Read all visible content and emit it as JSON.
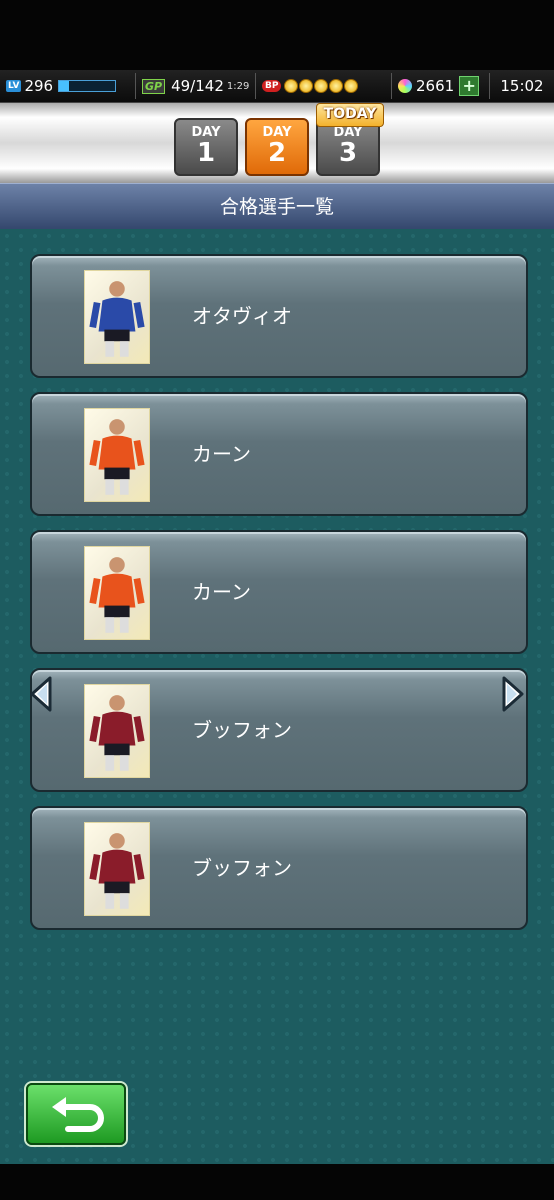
{
  "status": {
    "lv_label": "LV",
    "level": "296",
    "level_progress": 0.18,
    "gp_label": "GP",
    "gp_value": "49/142",
    "gp_timer": "1:29",
    "bp_label": "BP",
    "bp_count": 5,
    "gems": "2661",
    "clock": "15:02",
    "icons": [
      "lv-badge",
      "gp-badge",
      "bp-coin-icon",
      "gem-icon",
      "plus-icon"
    ]
  },
  "days": {
    "today_label": "TODAY",
    "items": [
      {
        "label": "DAY",
        "number": "1",
        "selected": false
      },
      {
        "label": "DAY",
        "number": "2",
        "selected": true
      },
      {
        "label": "DAY",
        "number": "3",
        "selected": false
      }
    ]
  },
  "title": "合格選手一覧",
  "players": [
    {
      "name": "オタヴィオ",
      "kit_color": "#2a4aa8"
    },
    {
      "name": "カーン",
      "kit_color": "#e8531c"
    },
    {
      "name": "カーン",
      "kit_color": "#e8531c"
    },
    {
      "name": "ブッフォン",
      "kit_color": "#8a1c2a"
    },
    {
      "name": "ブッフォン",
      "kit_color": "#8a1c2a"
    }
  ],
  "colors": {
    "panel": "#1d5c60",
    "selected_day": "#f08a1c",
    "back_button": "#2fb52f"
  },
  "icons": {
    "back": "return-arrow-icon",
    "prev": "left-arrow-icon",
    "next": "right-arrow-icon"
  }
}
